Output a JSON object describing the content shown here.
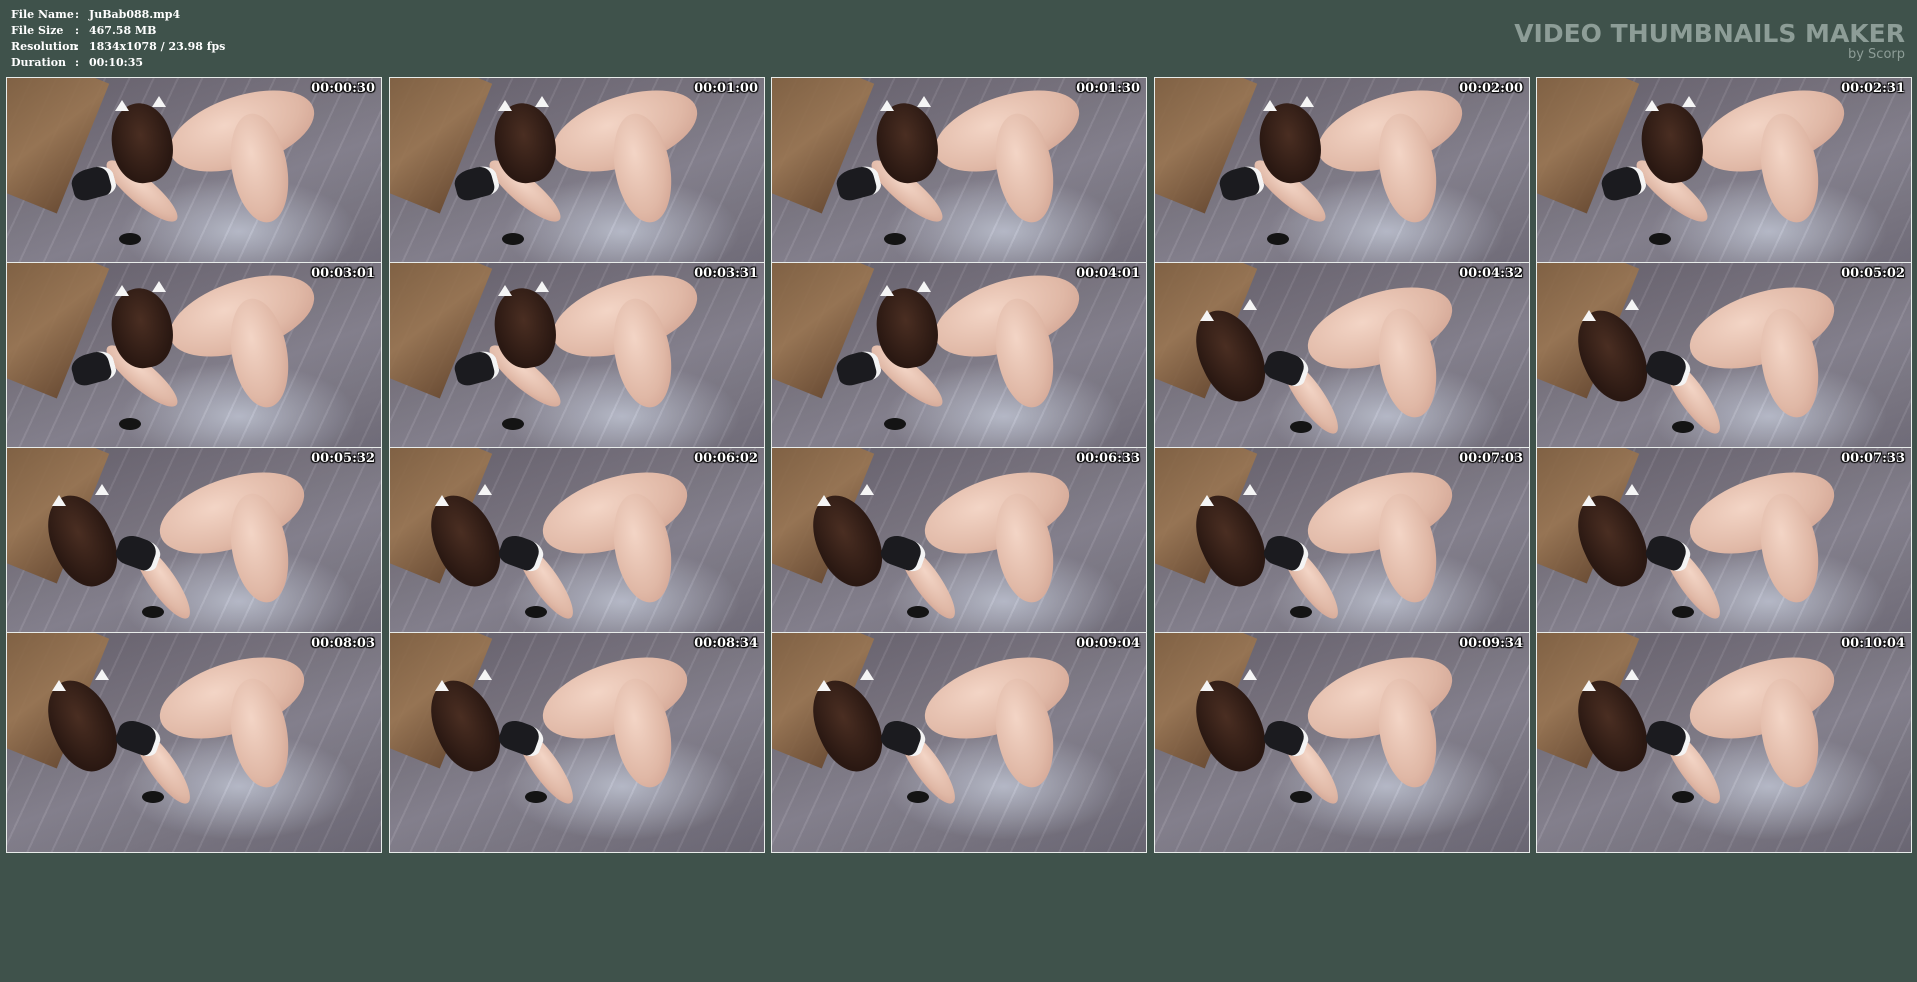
{
  "file_info": [
    {
      "label": "File Name",
      "sep": ":",
      "value": "JuBab088.mp4"
    },
    {
      "label": "File Size",
      "sep": ":",
      "value": "467.58 MB"
    },
    {
      "label": "Resolution",
      "sep": ":",
      "value": "1834x1078 / 23.98 fps"
    },
    {
      "label": "Duration",
      "sep": ":",
      "value": "00:10:35"
    }
  ],
  "watermark": {
    "title": "VIDEO THUMBNAILS MAKER",
    "subtitle": "by Scorp"
  },
  "thumbnails": [
    {
      "time": "00:00:30"
    },
    {
      "time": "00:01:00"
    },
    {
      "time": "00:01:30"
    },
    {
      "time": "00:02:00"
    },
    {
      "time": "00:02:31"
    },
    {
      "time": "00:03:01"
    },
    {
      "time": "00:03:31"
    },
    {
      "time": "00:04:01"
    },
    {
      "time": "00:04:32"
    },
    {
      "time": "00:05:02"
    },
    {
      "time": "00:05:32"
    },
    {
      "time": "00:06:02"
    },
    {
      "time": "00:06:33"
    },
    {
      "time": "00:07:03"
    },
    {
      "time": "00:07:33"
    },
    {
      "time": "00:08:03"
    },
    {
      "time": "00:08:34"
    },
    {
      "time": "00:09:04"
    },
    {
      "time": "00:09:34"
    },
    {
      "time": "00:10:04"
    }
  ],
  "colors": {
    "background": "#3f524b",
    "watermark": "#8d9d97",
    "text": "#ffffff"
  }
}
